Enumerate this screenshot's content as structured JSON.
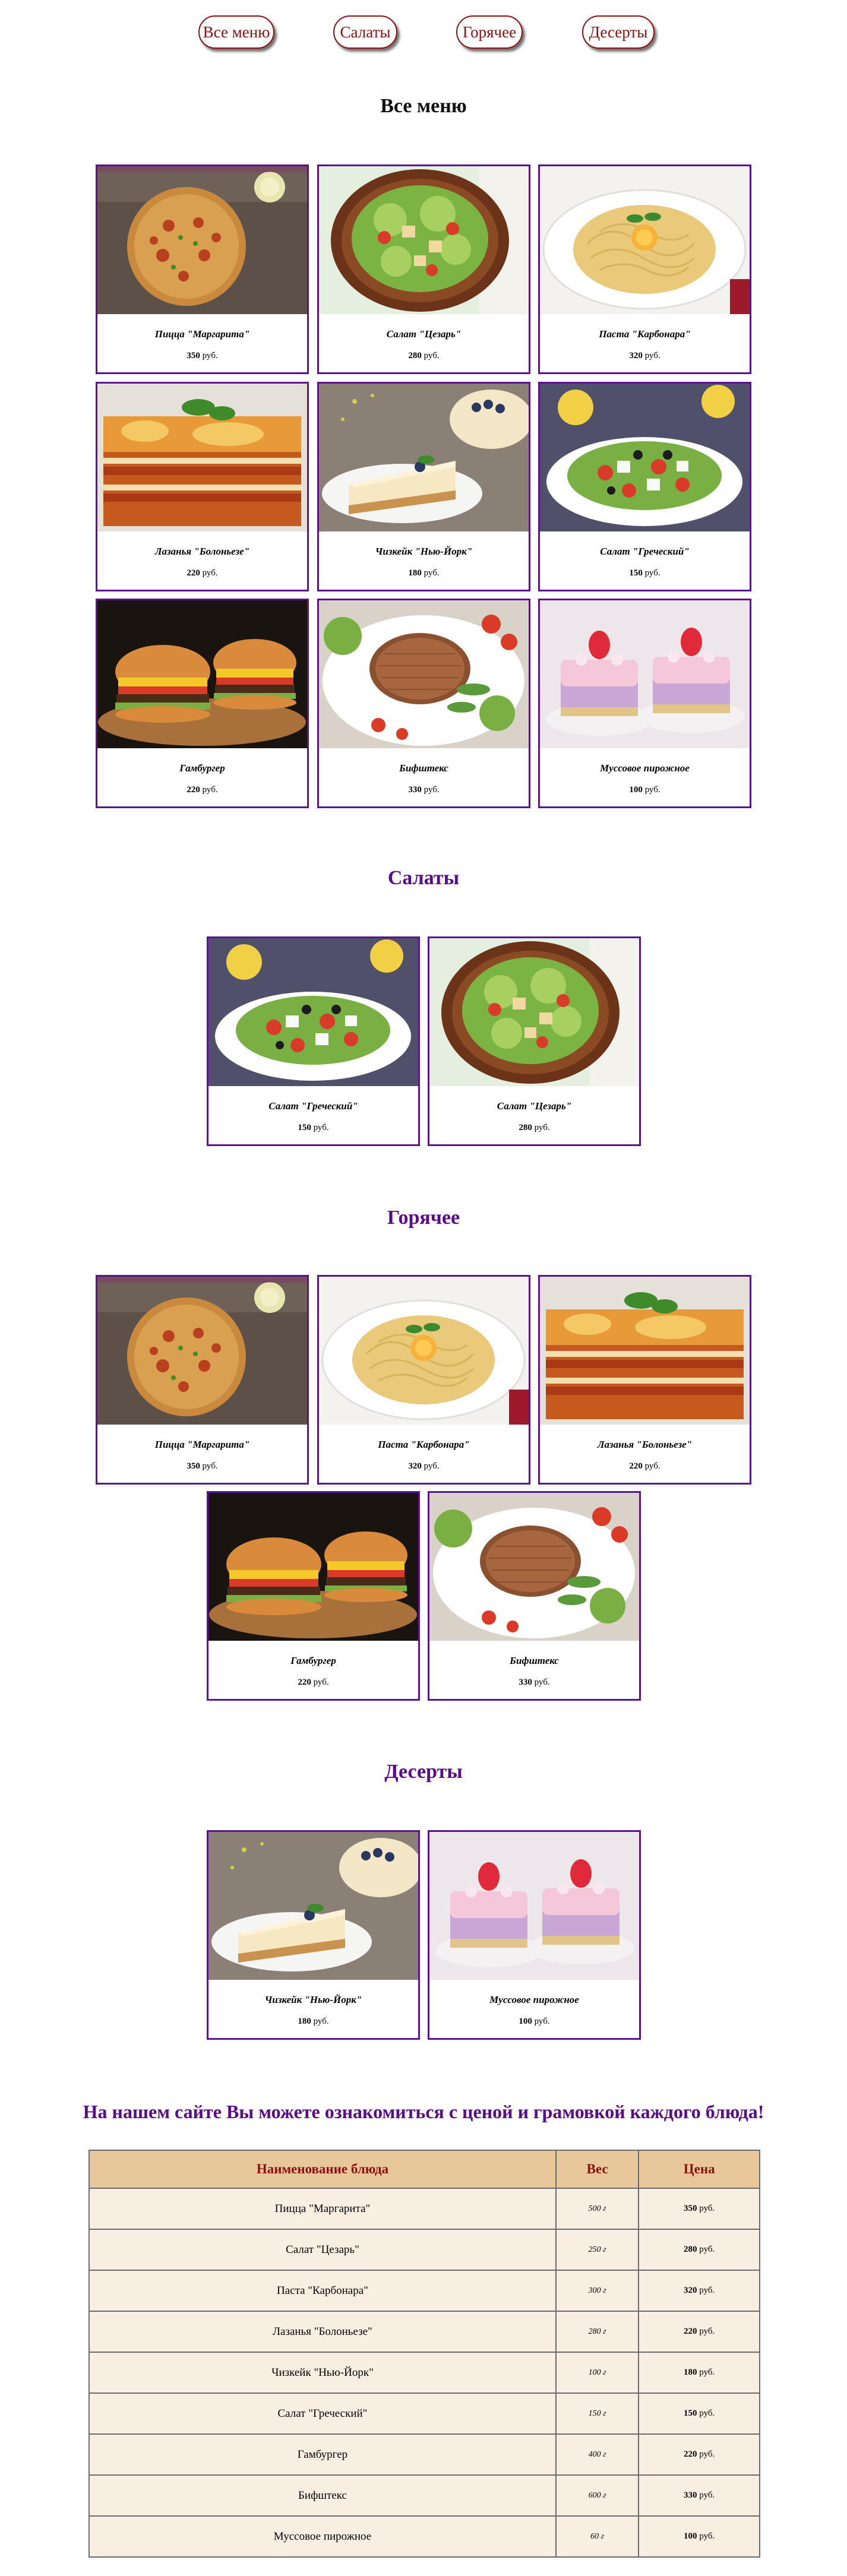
{
  "nav": {
    "all": "Все меню",
    "salads": "Салаты",
    "hot": "Горячее",
    "desserts": "Десерты"
  },
  "sections": {
    "all_title": "Все меню",
    "salads_title": "Салаты",
    "hot_title": "Горячее",
    "desserts_title": "Десерты"
  },
  "currency": "руб.",
  "dishes": {
    "pizza": {
      "name": "Пицца \"Маргарита\"",
      "price": "350",
      "weight": "500 г"
    },
    "caesar": {
      "name": "Салат \"Цезарь\"",
      "price": "280",
      "weight": "250 г"
    },
    "carbonara": {
      "name": "Паста \"Карбонара\"",
      "price": "320",
      "weight": "300 г"
    },
    "lasagna": {
      "name": "Лазанья \"Болоньезе\"",
      "price": "220",
      "weight": "280 г"
    },
    "cheesecake": {
      "name": "Чизкейк \"Нью-Йорк\"",
      "price": "180",
      "weight": "100 г"
    },
    "greek": {
      "name": "Салат \"Греческий\"",
      "price": "150",
      "weight": "150 г"
    },
    "burger": {
      "name": "Гамбургер",
      "price": "220",
      "weight": "400 г"
    },
    "steak": {
      "name": "Бифштекс",
      "price": "330",
      "weight": "600 г"
    },
    "mousse": {
      "name": "Муссовое пирожное",
      "price": "100",
      "weight": "60 г"
    }
  },
  "table_names": {
    "pizza": "Пицца \"Маргарита\"",
    "caesar": "Салат \"Цезарь\"",
    "carbonara": "Паста \"Карбонара\"",
    "lasagna": "Лазанья \"Болоньезе\"",
    "cheesecake": "Чизкейк \"Нью-Йорк\"",
    "greek": "Салат \"Греческий\"",
    "burger": "Гамбургер",
    "steak": "Бифштекс",
    "mousse": "Муссовое пирожное"
  },
  "promo": "На нашем сайте Вы можете ознакомиться с ценой и грамовкой каждого блюда!",
  "table_headers": {
    "name": "Наименование блюда",
    "weight": "Вес",
    "price": "Цена"
  },
  "colors": {
    "accent": "#5a0a8c",
    "nav_text": "#8b1010",
    "table_header_bg": "#e8c89a",
    "table_row_bg": "#f9eee2"
  }
}
